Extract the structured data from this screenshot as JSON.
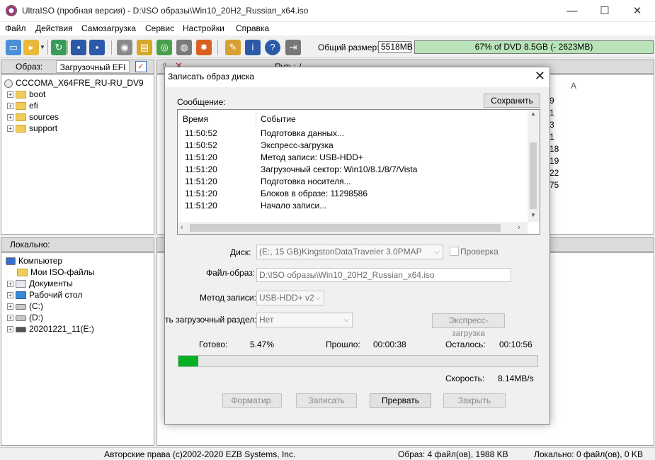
{
  "window": {
    "title": "UltraISO (пробная версия) - D:\\ISO образы\\Win10_20H2_Russian_x64.iso",
    "minimize": "—",
    "maximize": "☐",
    "close": "✕"
  },
  "menu": [
    "Файл",
    "Действия",
    "Самозагрузка",
    "Сервис",
    "Настройки",
    "Справка"
  ],
  "toolbar": {
    "size_label": "Общий размер:",
    "size_value": "5518MB",
    "dvd_bar_text": "67% of DVD 8.5GB (- 2623MB)",
    "dvd_fill_fraction": 0.67
  },
  "image_panel": {
    "label": "Образ:",
    "boot_button": "Загрузочный EFI",
    "path_label": "Путь:",
    "path_value": "/",
    "root": "CCCOMA_X64FRE_RU-RU_DV9",
    "folders": [
      "boot",
      "efi",
      "sources",
      "support"
    ],
    "right_col_header": "А",
    "right_col_values": [
      "9",
      "1",
      "3",
      "1",
      "18",
      "19",
      "22",
      "75"
    ]
  },
  "local_panel": {
    "label": "Локально:",
    "items": [
      "Компьютер",
      "Мои ISO-файлы",
      "Документы",
      "Рабочий стол",
      "(C:)",
      "(D:)",
      "20201221_11(E:)"
    ]
  },
  "status_bar": {
    "copyright": "Авторские права (c)2002-2020 EZB Systems, Inc.",
    "image_info": "Образ: 4 файл(ов), 1988 KB",
    "local_info": "Локально: 0 файл(ов), 0 KB"
  },
  "dialog": {
    "title": "Записать образ диска",
    "close": "✕",
    "message_label": "Сообщение:",
    "save_button": "Сохранить",
    "columns": [
      "Время",
      "Событие"
    ],
    "log": [
      {
        "time": "11:50:52",
        "event": "Подготовка данных..."
      },
      {
        "time": "11:50:52",
        "event": "Экспресс-загрузка"
      },
      {
        "time": "11:51:20",
        "event": "Метод записи: USB-HDD+"
      },
      {
        "time": "11:51:20",
        "event": "Загрузочный сектор: Win10/8.1/8/7/Vista"
      },
      {
        "time": "11:51:20",
        "event": "Подготовка носителя..."
      },
      {
        "time": "11:51:20",
        "event": "Блоков в образе: 11298586"
      },
      {
        "time": "11:51:20",
        "event": "Начало записи..."
      }
    ],
    "disk_label": "Диск:",
    "disk_value": "(E:, 15 GB)KingstonDataTraveler 3.0PMAP",
    "verify_label": "Проверка",
    "image_file_label": "Файл-образ:",
    "image_file_value": "D:\\ISO образы\\Win10_20H2_Russian_x64.iso",
    "write_method_label": "Метод записи:",
    "write_method_value": "USB-HDD+ v2",
    "boot_partition_label": "ть загрузочный раздел:",
    "boot_partition_value": "Нет",
    "express_button": "Экспресс-загрузка",
    "done_label": "Готово:",
    "done_value": "5.47%",
    "elapsed_label": "Прошло:",
    "elapsed_value": "00:00:38",
    "remaining_label": "Осталось:",
    "remaining_value": "00:10:56",
    "progress_fraction": 0.0547,
    "speed_label": "Скорость:",
    "speed_value": "8.14MB/s",
    "buttons": {
      "format": "Форматир.",
      "write": "Записать",
      "abort": "Прервать",
      "close": "Закрыть"
    },
    "progress_color": "#06b025"
  }
}
